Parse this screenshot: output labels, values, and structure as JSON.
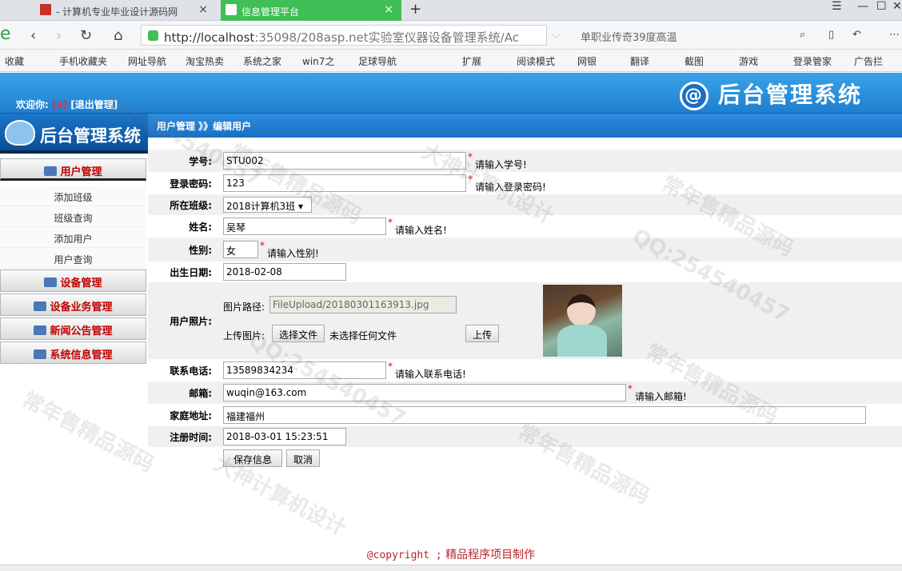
{
  "browser": {
    "tab1_title": "- 计算机专业毕业设计源码网",
    "tab2_title": "信息管理平台",
    "url_host": "http://localhost",
    "url_rest": ":35098/208asp.net实验室仪器设备管理系统/Ac",
    "search_hint": "单职业传奇39度高温",
    "bookmarks": [
      "收藏",
      "手机收藏夹",
      "网址导航",
      "淘宝热卖",
      "系统之家",
      "win7之",
      "足球导航",
      "扩展",
      "阅读模式",
      "网银",
      "翻译",
      "截图",
      "游戏",
      "登录管家",
      "广告拦"
    ]
  },
  "header": {
    "welcome": "欢迎你:",
    "user": "[a]",
    "logout": "[退出管理]",
    "brand": "后台管理系统"
  },
  "sidebar": {
    "brand": "后台管理系统",
    "menus": [
      {
        "label": "用户管理",
        "items": [
          "添加班级",
          "班级查询",
          "添加用户",
          "用户查询"
        ]
      },
      {
        "label": "设备管理"
      },
      {
        "label": "设备业务管理"
      },
      {
        "label": "新闻公告管理"
      },
      {
        "label": "系统信息管理"
      }
    ]
  },
  "breadcrumb": "用户管理 》》编辑用户",
  "form": {
    "fields": {
      "student_no": {
        "label": "学号:",
        "value": "STU002",
        "hint": "请输入学号!"
      },
      "password": {
        "label": "登录密码:",
        "value": "123",
        "hint": "请输入登录密码!"
      },
      "class": {
        "label": "所在班级:",
        "value": "2018计算机3班"
      },
      "name": {
        "label": "姓名:",
        "value": "吴琴",
        "hint": "请输入姓名!"
      },
      "gender": {
        "label": "性别:",
        "value": "女",
        "hint": "请输入性别!"
      },
      "birthday": {
        "label": "出生日期:",
        "value": "2018-02-08"
      },
      "photo": {
        "label": "用户照片:",
        "path_label": "图片路径:",
        "path_value": "FileUpload/20180301163913.jpg",
        "upload_label": "上传图片:",
        "choose_button": "选择文件",
        "no_file": "未选择任何文件",
        "upload_button": "上传"
      },
      "phone": {
        "label": "联系电话:",
        "value": "13589834234",
        "hint": "请输入联系电话!"
      },
      "email": {
        "label": "邮箱:",
        "value": "wuqin@163.com",
        "hint": "请输入邮箱!"
      },
      "address": {
        "label": "家庭地址:",
        "value": "福建福州"
      },
      "reg_time": {
        "label": "注册时间:",
        "value": "2018-03-01 15:23:51"
      }
    },
    "save_button": "保存信息",
    "cancel_button": "取消"
  },
  "footer": {
    "copyright": "@copyright ;",
    "credit": "精品程序项目制作"
  },
  "watermarks": [
    "QQ:254540457",
    "常年售精品源码",
    "大神计算机设计"
  ],
  "colors": {
    "header_blue": "#1e7fd0",
    "menu_red": "#c00000",
    "required_red": "#e00000",
    "tab_green": "#3fbf55"
  }
}
